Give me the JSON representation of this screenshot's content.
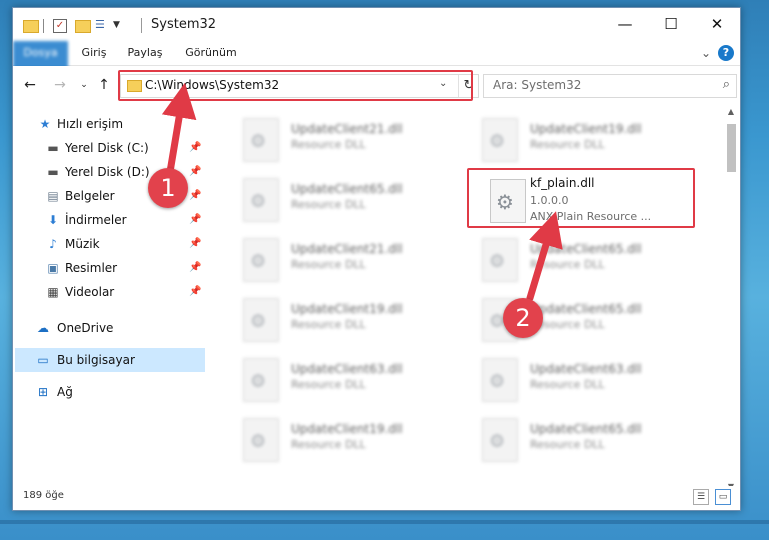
{
  "window": {
    "title": "System32"
  },
  "ribbon": {
    "tabs": [
      "Dosya",
      "Giriş",
      "Paylaş",
      "Görünüm"
    ],
    "help": "?"
  },
  "address": {
    "path": "C:\\Windows\\System32"
  },
  "search": {
    "placeholder": "Ara: System32"
  },
  "sidebar": {
    "items": [
      {
        "label": "Hızlı erişim"
      },
      {
        "label": "Yerel Disk (C:)"
      },
      {
        "label": "Yerel Disk (D:)"
      },
      {
        "label": "Belgeler"
      },
      {
        "label": "İndirmeler"
      },
      {
        "label": "Müzik"
      },
      {
        "label": "Resimler"
      },
      {
        "label": "Videolar"
      },
      {
        "label": "OneDrive"
      },
      {
        "label": "Bu bilgisayar"
      },
      {
        "label": "Ağ"
      }
    ]
  },
  "files": [
    {
      "name": "UpdateClient21.dll",
      "desc": "Resource DLL"
    },
    {
      "name": "UpdateClient19.dll",
      "desc": "Resource DLL"
    },
    {
      "name": "UpdateClient65.dll",
      "desc": "Resource DLL"
    },
    {
      "name": "UpdateClient21.dll",
      "desc": "Resource DLL"
    },
    {
      "name": "UpdateClient65.dll",
      "desc": "Resource DLL"
    },
    {
      "name": "UpdateClient19.dll",
      "desc": "Resource DLL"
    },
    {
      "name": "UpdateClient65.dll",
      "desc": "Resource DLL"
    },
    {
      "name": "UpdateClient63.dll",
      "desc": "Resource DLL"
    },
    {
      "name": "UpdateClient63.dll",
      "desc": "Resource DLL"
    },
    {
      "name": "UpdateClient19.dll",
      "desc": "Resource DLL"
    },
    {
      "name": "UpdateClient65.dll",
      "desc": "Resource DLL"
    }
  ],
  "highlighted_file": {
    "name": "kf_plain.dll",
    "version": "1.0.0.0",
    "desc": "ANX Plain Resource ..."
  },
  "status": {
    "count": "189 öğe"
  },
  "annotations": {
    "step1": "1",
    "step2": "2",
    "color": "#e03a46"
  }
}
